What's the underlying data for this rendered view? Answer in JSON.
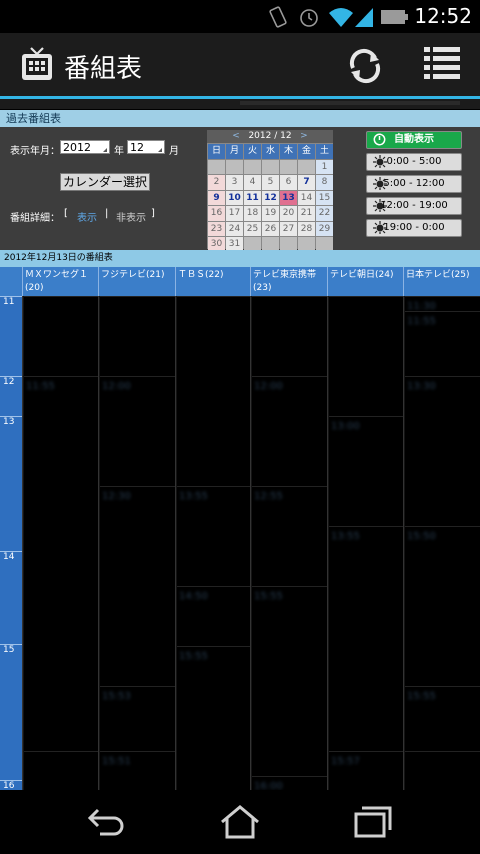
{
  "statusbar": {
    "time": "12:52"
  },
  "app": {
    "title": "番組表"
  },
  "section": {
    "title": "過去番組表"
  },
  "controls": {
    "display_label": "表示年月：",
    "year_value": "2012",
    "year_label": "年",
    "month_value": "12",
    "month_label": "月",
    "calendar_button": "カレンダー選択",
    "detail_label": "番組詳細：",
    "bracket_open": "[",
    "show_link": "表示",
    "separator": "|",
    "hide_link": "非表示",
    "bracket_close": "]"
  },
  "calendar": {
    "prev": "<",
    "month": "2012 / 12",
    "next": ">",
    "dows": [
      "日",
      "月",
      "火",
      "水",
      "木",
      "金",
      "土"
    ],
    "rows": [
      [
        "",
        "",
        "",
        "",
        "",
        "",
        "1"
      ],
      [
        "2",
        "3",
        "4",
        "5",
        "6",
        "7",
        "8"
      ],
      [
        "9",
        "10",
        "11",
        "12",
        "13",
        "14",
        "15"
      ],
      [
        "16",
        "17",
        "18",
        "19",
        "20",
        "21",
        "22"
      ],
      [
        "23",
        "24",
        "25",
        "26",
        "27",
        "28",
        "29"
      ],
      [
        "30",
        "31",
        "",
        "",
        "",
        "",
        ""
      ]
    ],
    "linked_days": [
      "7",
      "9",
      "10",
      "11",
      "12",
      "13"
    ],
    "today": "13"
  },
  "time_buttons": [
    {
      "label": "自動表示",
      "icon": "clock-icon"
    },
    {
      "label": "0:00 - 5:00",
      "icon": "night-house-icon"
    },
    {
      "label": "5:00 - 12:00",
      "icon": "morning-sun-icon"
    },
    {
      "label": "12:00 - 19:00",
      "icon": "noon-sun-icon"
    },
    {
      "label": "19:00 - 0:00",
      "icon": "evening-house-icon"
    }
  ],
  "schedule": {
    "date_title": "2012年12月13日の番組表",
    "channels": [
      {
        "name": "ＭＸワンセグ１",
        "num": "(20)"
      },
      {
        "name": "フジテレビ",
        "num": "(21)"
      },
      {
        "name": "ＴＢＳ",
        "num": "(22)"
      },
      {
        "name": "テレビ東京携帯",
        "num": "(23)"
      },
      {
        "name": "テレビ朝日",
        "num": "(24)"
      },
      {
        "name": "日本テレビ",
        "num": "(25)"
      }
    ],
    "hours": [
      "11",
      "12",
      "13",
      "14",
      "15",
      "16"
    ],
    "program_times": [
      [
        "",
        "11:55",
        "",
        "15:55"
      ],
      [
        "",
        "12:00",
        "12:30",
        "15:53",
        "15:51"
      ],
      [
        "",
        "13:55",
        "14:50",
        "15:55"
      ],
      [
        "",
        "12:00",
        "12:55",
        "15:55",
        "16:00"
      ],
      [
        "",
        "13:00",
        "13:55",
        "15:57"
      ],
      [
        "11:30",
        "11:55",
        "13:30",
        "15:50",
        "15:55"
      ]
    ]
  },
  "colors": {
    "accent": "#33b5e5",
    "channel_header": "#3b7ec9",
    "auto_button": "#19a84a"
  }
}
